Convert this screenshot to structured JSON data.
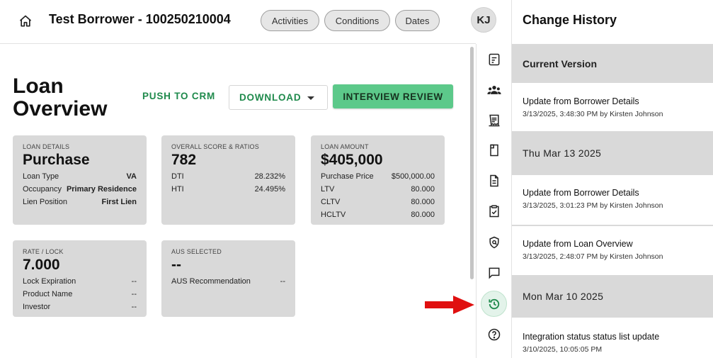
{
  "header": {
    "borrower_title": "Test Borrower - 100250210004",
    "pills": [
      "Activities",
      "Conditions",
      "Dates"
    ],
    "avatar_initials": "KJ"
  },
  "main": {
    "page_title": "Loan Overview",
    "push_crm_label": "PUSH TO CRM",
    "download_label": "DOWNLOAD",
    "interview_label": "INTERVIEW REVIEW"
  },
  "cards": {
    "loan_details": {
      "label": "LOAN DETAILS",
      "big": "Purchase",
      "rows": [
        {
          "k": "Loan Type",
          "v": "VA"
        },
        {
          "k": "Occupancy",
          "v": "Primary Residence"
        },
        {
          "k": "Lien Position",
          "v": "First Lien"
        }
      ]
    },
    "score": {
      "label": "OVERALL SCORE & RATIOS",
      "big": "782",
      "rows": [
        {
          "k": "DTI",
          "v": "28.232%"
        },
        {
          "k": "HTI",
          "v": "24.495%"
        }
      ]
    },
    "amount": {
      "label": "LOAN AMOUNT",
      "big": "$405,000",
      "rows": [
        {
          "k": "Purchase Price",
          "v": "$500,000.00"
        },
        {
          "k": "LTV",
          "v": "80.000"
        },
        {
          "k": "CLTV",
          "v": "80.000"
        },
        {
          "k": "HCLTV",
          "v": "80.000"
        }
      ]
    },
    "rate": {
      "label": "RATE / LOCK",
      "big": "7.000",
      "rows": [
        {
          "k": "Lock Expiration",
          "v": "--"
        },
        {
          "k": "Product Name",
          "v": "--"
        },
        {
          "k": "Investor",
          "v": "--"
        }
      ]
    },
    "aus": {
      "label": "AUS SELECTED",
      "big": "--",
      "rows": [
        {
          "k": "AUS Recommendation",
          "v": "--"
        }
      ]
    }
  },
  "rail": {
    "icons": [
      "form-icon",
      "people-icon",
      "receipt-icon",
      "document-corner-icon",
      "document-lines-icon",
      "clipboard-check-icon",
      "shield-icon",
      "chat-icon",
      "history-icon",
      "help-icon"
    ],
    "active": "history-icon",
    "accent": "#1f8a4c"
  },
  "history": {
    "title": "Change History",
    "current_header": "Current Version",
    "groups": [
      {
        "header": "Thu Mar 13 2025"
      },
      {
        "header": "Mon Mar 10 2025"
      }
    ],
    "items": [
      {
        "title": "Update from Borrower Details",
        "meta": "3/13/2025, 3:48:30 PM by Kirsten Johnson"
      },
      {
        "title": "Update from Borrower Details",
        "meta": "3/13/2025, 3:01:23 PM by Kirsten Johnson"
      },
      {
        "title": "Update from Loan Overview",
        "meta": "3/13/2025, 2:48:07 PM by Kirsten Johnson"
      },
      {
        "title": "Integration status status list update",
        "meta": "3/10/2025, 10:05:05 PM"
      }
    ]
  },
  "colors": {
    "green_button": "#5cc98a",
    "green_text": "#1f8a4c",
    "card_bg": "#d9d9d9",
    "annotation_arrow": "#e01010"
  }
}
